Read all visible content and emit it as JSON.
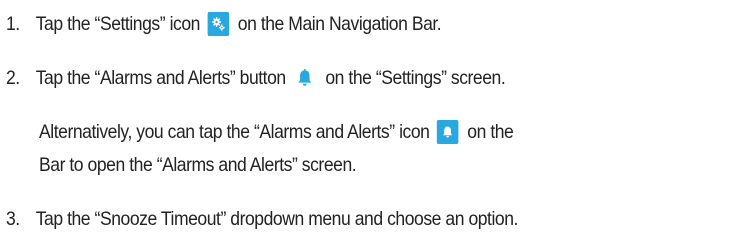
{
  "steps": [
    {
      "number": "1.",
      "before": "Tap the “Settings” icon",
      "icon": "gears-icon",
      "after": "on the Main Navigation Bar."
    },
    {
      "number": "2.",
      "before": "Tap the “Alarms and Alerts” button",
      "icon": "bell-icon",
      "after": "on the “Settings” screen."
    },
    {
      "number": "3.",
      "text": "Tap the “Snooze Timeout” dropdown menu and choose an option."
    }
  ],
  "alternative": {
    "before": "Alternatively, you can tap the “Alarms and Alerts” icon",
    "icon": "bell-icon",
    "after": "on the",
    "line2": "Bar to open the “Alarms and Alerts” screen."
  },
  "colors": {
    "icon_background": "#29a8e0",
    "bell_blue": "#29a8e0",
    "text": "#222222"
  }
}
